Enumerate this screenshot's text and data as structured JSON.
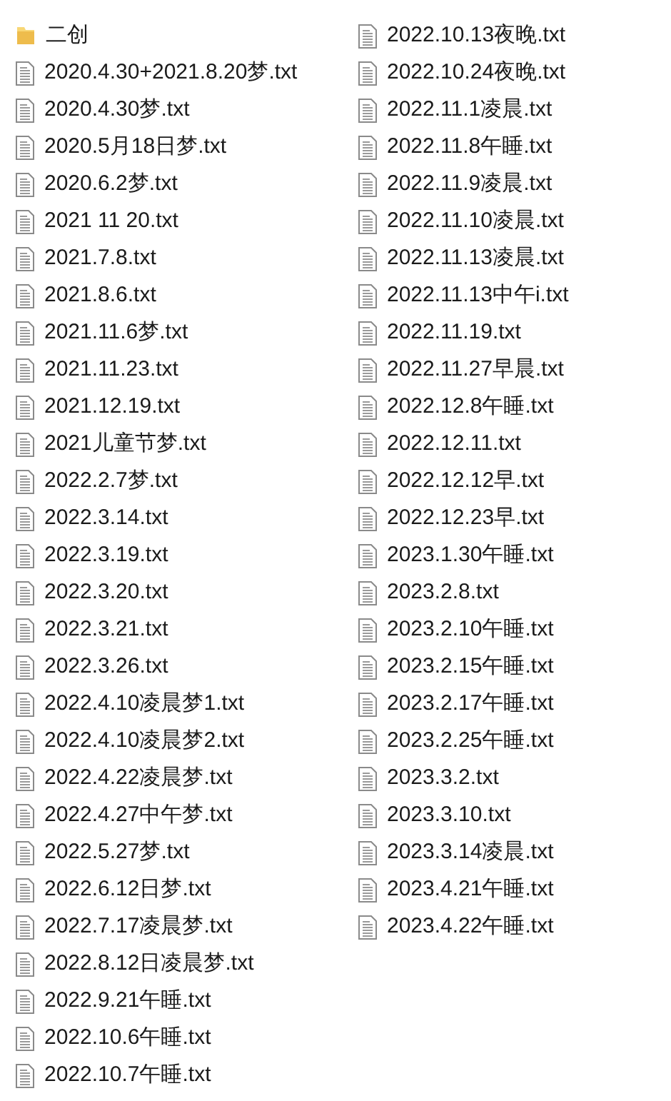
{
  "files": [
    {
      "kind": "folder",
      "name": "二创"
    },
    {
      "kind": "file",
      "name": "2020.4.30+2021.8.20梦.txt"
    },
    {
      "kind": "file",
      "name": "2020.4.30梦.txt"
    },
    {
      "kind": "file",
      "name": "2020.5月18日梦.txt"
    },
    {
      "kind": "file",
      "name": "2020.6.2梦.txt"
    },
    {
      "kind": "file",
      "name": "2021 11 20.txt"
    },
    {
      "kind": "file",
      "name": "2021.7.8.txt"
    },
    {
      "kind": "file",
      "name": "2021.8.6.txt"
    },
    {
      "kind": "file",
      "name": "2021.11.6梦.txt"
    },
    {
      "kind": "file",
      "name": "2021.11.23.txt"
    },
    {
      "kind": "file",
      "name": "2021.12.19.txt"
    },
    {
      "kind": "file",
      "name": "2021儿童节梦.txt"
    },
    {
      "kind": "file",
      "name": "2022.2.7梦.txt"
    },
    {
      "kind": "file",
      "name": "2022.3.14.txt"
    },
    {
      "kind": "file",
      "name": "2022.3.19.txt"
    },
    {
      "kind": "file",
      "name": "2022.3.20.txt"
    },
    {
      "kind": "file",
      "name": "2022.3.21.txt"
    },
    {
      "kind": "file",
      "name": "2022.3.26.txt"
    },
    {
      "kind": "file",
      "name": "2022.4.10凌晨梦1.txt"
    },
    {
      "kind": "file",
      "name": "2022.4.10凌晨梦2.txt"
    },
    {
      "kind": "file",
      "name": "2022.4.22凌晨梦.txt"
    },
    {
      "kind": "file",
      "name": "2022.4.27中午梦.txt"
    },
    {
      "kind": "file",
      "name": "2022.5.27梦.txt"
    },
    {
      "kind": "file",
      "name": "2022.6.12日梦.txt"
    },
    {
      "kind": "file",
      "name": "2022.7.17凌晨梦.txt"
    },
    {
      "kind": "file",
      "name": "2022.8.12日凌晨梦.txt"
    },
    {
      "kind": "file",
      "name": "2022.9.21午睡.txt"
    },
    {
      "kind": "file",
      "name": "2022.10.6午睡.txt"
    },
    {
      "kind": "file",
      "name": "2022.10.7午睡.txt"
    },
    {
      "kind": "file",
      "name": "2022.10.13夜晚.txt"
    },
    {
      "kind": "file",
      "name": "2022.10.24夜晚.txt"
    },
    {
      "kind": "file",
      "name": "2022.11.1凌晨.txt"
    },
    {
      "kind": "file",
      "name": "2022.11.8午睡.txt"
    },
    {
      "kind": "file",
      "name": "2022.11.9凌晨.txt"
    },
    {
      "kind": "file",
      "name": "2022.11.10凌晨.txt"
    },
    {
      "kind": "file",
      "name": "2022.11.13凌晨.txt"
    },
    {
      "kind": "file",
      "name": "2022.11.13中午i.txt"
    },
    {
      "kind": "file",
      "name": "2022.11.19.txt"
    },
    {
      "kind": "file",
      "name": "2022.11.27早晨.txt"
    },
    {
      "kind": "file",
      "name": "2022.12.8午睡.txt"
    },
    {
      "kind": "file",
      "name": "2022.12.11.txt"
    },
    {
      "kind": "file",
      "name": "2022.12.12早.txt"
    },
    {
      "kind": "file",
      "name": "2022.12.23早.txt"
    },
    {
      "kind": "file",
      "name": "2023.1.30午睡.txt"
    },
    {
      "kind": "file",
      "name": "2023.2.8.txt"
    },
    {
      "kind": "file",
      "name": "2023.2.10午睡.txt"
    },
    {
      "kind": "file",
      "name": "2023.2.15午睡.txt"
    },
    {
      "kind": "file",
      "name": "2023.2.17午睡.txt"
    },
    {
      "kind": "file",
      "name": "2023.2.25午睡.txt"
    },
    {
      "kind": "file",
      "name": "2023.3.2.txt"
    },
    {
      "kind": "file",
      "name": "2023.3.10.txt"
    },
    {
      "kind": "file",
      "name": "2023.3.14凌晨.txt"
    },
    {
      "kind": "file",
      "name": "2023.4.21午睡.txt"
    },
    {
      "kind": "file",
      "name": "2023.4.22午睡.txt"
    }
  ]
}
